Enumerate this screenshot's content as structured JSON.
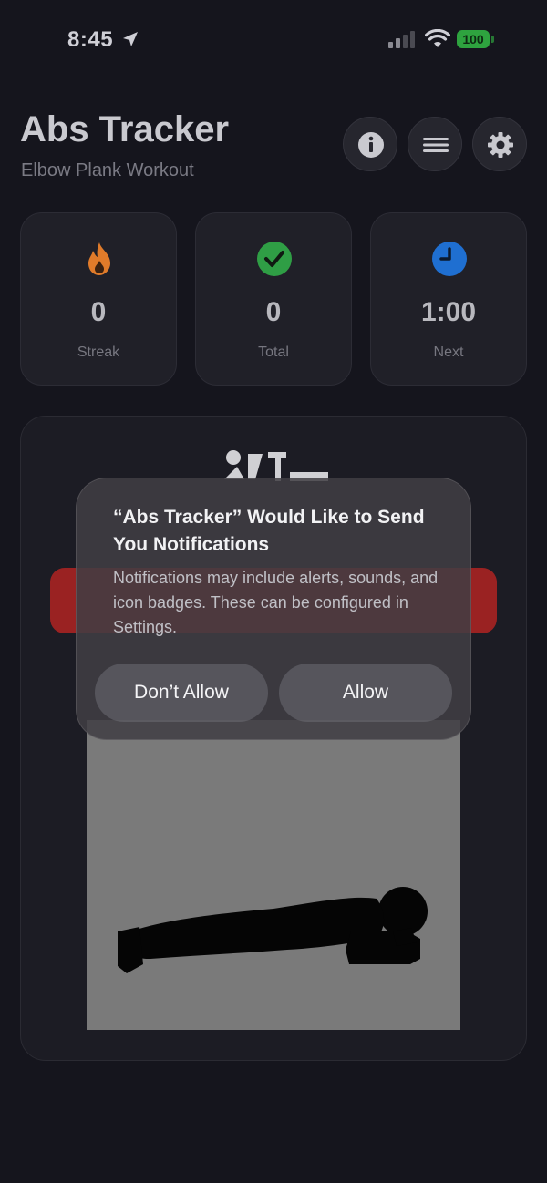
{
  "status_bar": {
    "time": "8:45",
    "battery": "100",
    "icons": [
      "location-arrow-icon",
      "cellular-signal-icon",
      "wifi-icon",
      "battery-icon"
    ]
  },
  "header": {
    "title": "Abs Tracker",
    "subtitle": "Elbow Plank Workout",
    "buttons": [
      "info-icon",
      "menu-icon",
      "gear-icon"
    ]
  },
  "stats": [
    {
      "icon": "flame-icon",
      "value": "0",
      "label": "Streak",
      "color": "#e07b2a"
    },
    {
      "icon": "checkmark-icon",
      "value": "0",
      "label": "Total",
      "color": "#2f9e45"
    },
    {
      "icon": "clock-icon",
      "value": "1:00",
      "label": "Next",
      "color": "#1f6fd1"
    }
  ],
  "workout": {
    "logo_icon": "plank-logo-icon",
    "illustration": "elbow-plank-figure",
    "start_bar_color": "#9a2222"
  },
  "alert": {
    "title": "“Abs Tracker” Would Like to Send You Notifications",
    "message": "Notifications may include alerts, sounds, and icon badges. These can be configured in Settings.",
    "deny_label": "Don’t Allow",
    "allow_label": "Allow"
  }
}
